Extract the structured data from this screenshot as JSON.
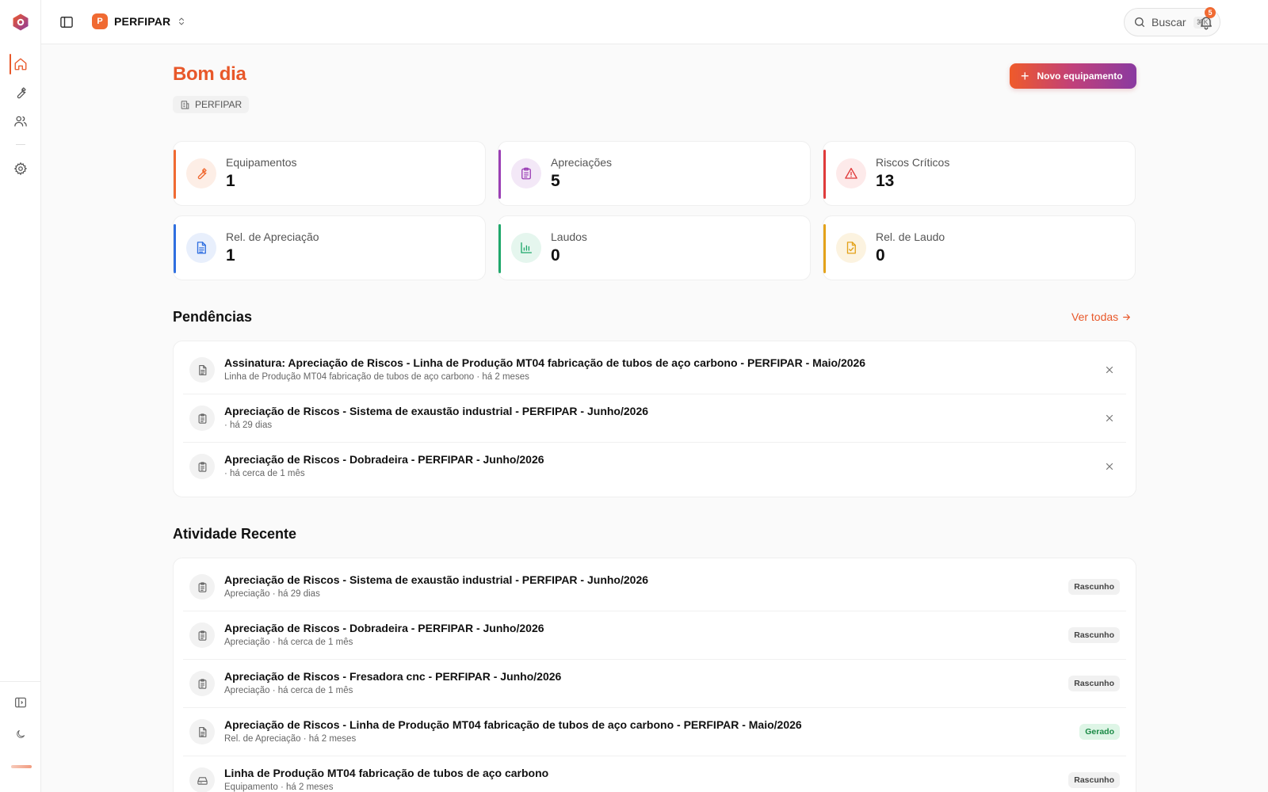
{
  "app": {
    "org_name": "PERFIPAR",
    "org_initial": "P",
    "search_label": "Buscar",
    "search_shortcut": "⌘K",
    "notifications_count": "5",
    "accent_color": "#e8582a"
  },
  "sidebar": {
    "items": [
      {
        "name": "home",
        "icon": "home-icon",
        "active": true
      },
      {
        "name": "equipamentos",
        "icon": "wrench-icon"
      },
      {
        "name": "usuarios",
        "icon": "users-icon"
      },
      {
        "name": "configuracoes",
        "icon": "gear-icon"
      }
    ],
    "bottom": [
      {
        "name": "expand-sidebar",
        "icon": "panel-icon"
      },
      {
        "name": "theme-toggle",
        "icon": "moon-icon"
      }
    ]
  },
  "header": {
    "greeting": "Bom dia",
    "org_chip": "PERFIPAR",
    "new_button": "Novo equipamento"
  },
  "stats": [
    {
      "label": "Equipamentos",
      "value": "1",
      "icon": "wrench-icon",
      "color": "#f06a32"
    },
    {
      "label": "Apreciações",
      "value": "5",
      "icon": "clipboard-icon",
      "color": "#9b3fb5"
    },
    {
      "label": "Riscos Críticos",
      "value": "13",
      "icon": "alert-triangle-icon",
      "color": "#e03b3b"
    },
    {
      "label": "Rel. de Apreciação",
      "value": "1",
      "icon": "file-text-icon",
      "color": "#2f6fe0"
    },
    {
      "label": "Laudos",
      "value": "0",
      "icon": "bar-chart-icon",
      "color": "#1fa86b"
    },
    {
      "label": "Rel. de Laudo",
      "value": "0",
      "icon": "file-check-icon",
      "color": "#e3a21a"
    }
  ],
  "pendencias": {
    "title": "Pendências",
    "see_all": "Ver todas",
    "items": [
      {
        "title": "Assinatura: Apreciação de Riscos - Linha de Produção MT04 fabricação de tubos de aço carbono - PERFIPAR - Maio/2026",
        "subtitle": "Linha de Produção MT04 fabricação de tubos de aço carbono · há 2 meses",
        "icon": "file-text-icon"
      },
      {
        "title": "Apreciação de Riscos - Sistema de exaustão industrial - PERFIPAR - Junho/2026",
        "subtitle": "· há 29 dias",
        "icon": "clipboard-icon"
      },
      {
        "title": "Apreciação de Riscos - Dobradeira - PERFIPAR - Junho/2026",
        "subtitle": "· há cerca de 1 mês",
        "icon": "clipboard-icon"
      }
    ]
  },
  "atividade": {
    "title": "Atividade Recente",
    "items": [
      {
        "title": "Apreciação de Riscos - Sistema de exaustão industrial - PERFIPAR - Junho/2026",
        "subtitle": "Apreciação · há 29 dias",
        "status": "Rascunho",
        "icon": "clipboard-icon"
      },
      {
        "title": "Apreciação de Riscos - Dobradeira - PERFIPAR - Junho/2026",
        "subtitle": "Apreciação · há cerca de 1 mês",
        "status": "Rascunho",
        "icon": "clipboard-icon"
      },
      {
        "title": "Apreciação de Riscos - Fresadora cnc - PERFIPAR - Junho/2026",
        "subtitle": "Apreciação · há cerca de 1 mês",
        "status": "Rascunho",
        "icon": "clipboard-icon"
      },
      {
        "title": "Apreciação de Riscos - Linha de Produção MT04 fabricação de tubos de aço carbono - PERFIPAR - Maio/2026",
        "subtitle": "Rel. de Apreciação · há 2 meses",
        "status": "Gerado",
        "icon": "file-text-icon"
      },
      {
        "title": "Linha de Produção MT04 fabricação de tubos de aço carbono",
        "subtitle": "Equipamento · há 2 meses",
        "status": "Rascunho",
        "icon": "hard-drive-icon"
      }
    ]
  }
}
